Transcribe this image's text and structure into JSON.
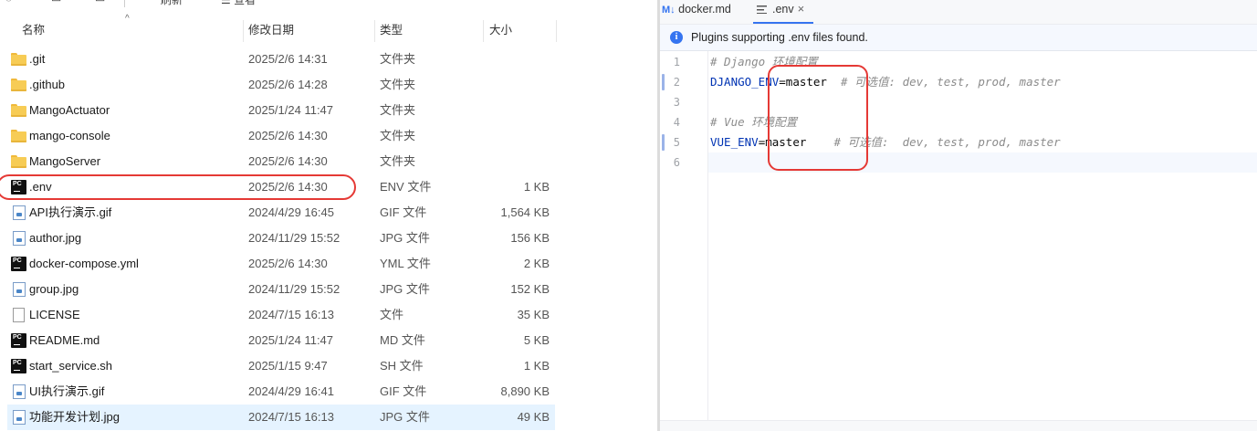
{
  "explorer": {
    "toolbar_fragments": [
      "刷新",
      "查看"
    ],
    "columns": {
      "name": "名称",
      "date": "修改日期",
      "type": "类型",
      "size": "大小"
    },
    "files": [
      {
        "name": ".git",
        "date": "2025/2/6 14:31",
        "type": "文件夹",
        "size": "",
        "icon": "folder-icon"
      },
      {
        "name": ".github",
        "date": "2025/2/6 14:28",
        "type": "文件夹",
        "size": "",
        "icon": "folder-icon"
      },
      {
        "name": "MangoActuator",
        "date": "2025/1/24 11:47",
        "type": "文件夹",
        "size": "",
        "icon": "folder-icon"
      },
      {
        "name": "mango-console",
        "date": "2025/2/6 14:30",
        "type": "文件夹",
        "size": "",
        "icon": "folder-icon"
      },
      {
        "name": "MangoServer",
        "date": "2025/2/6 14:30",
        "type": "文件夹",
        "size": "",
        "icon": "folder-icon"
      },
      {
        "name": ".env",
        "date": "2025/2/6 14:30",
        "type": "ENV 文件",
        "size": "1 KB",
        "icon": "pycharm-file-icon"
      },
      {
        "name": "API执行演示.gif",
        "date": "2024/4/29 16:45",
        "type": "GIF 文件",
        "size": "1,564 KB",
        "icon": "image-file-icon"
      },
      {
        "name": "author.jpg",
        "date": "2024/11/29 15:52",
        "type": "JPG 文件",
        "size": "156 KB",
        "icon": "image-file-icon"
      },
      {
        "name": "docker-compose.yml",
        "date": "2025/2/6 14:30",
        "type": "YML 文件",
        "size": "2 KB",
        "icon": "pycharm-file-icon"
      },
      {
        "name": "group.jpg",
        "date": "2024/11/29 15:52",
        "type": "JPG 文件",
        "size": "152 KB",
        "icon": "image-file-icon"
      },
      {
        "name": "LICENSE",
        "date": "2024/7/15 16:13",
        "type": "文件",
        "size": "35 KB",
        "icon": "blank-file-icon"
      },
      {
        "name": "README.md",
        "date": "2025/1/24 11:47",
        "type": "MD 文件",
        "size": "5 KB",
        "icon": "pycharm-file-icon"
      },
      {
        "name": "start_service.sh",
        "date": "2025/1/15 9:47",
        "type": "SH 文件",
        "size": "1 KB",
        "icon": "pycharm-file-icon"
      },
      {
        "name": "UI执行演示.gif",
        "date": "2024/4/29 16:41",
        "type": "GIF 文件",
        "size": "8,890 KB",
        "icon": "image-file-icon"
      },
      {
        "name": "功能开发计划.jpg",
        "date": "2024/7/15 16:13",
        "type": "JPG 文件",
        "size": "49 KB",
        "icon": "image-file-icon"
      }
    ],
    "selected_index": 14,
    "highlighted_index": 5
  },
  "editor": {
    "tabs": [
      {
        "badge": "M↓",
        "label": "docker.md",
        "active": false
      },
      {
        "label": ".env",
        "active": true,
        "close": "×"
      }
    ],
    "notice": {
      "icon": "i",
      "text": "Plugins supporting .env files found."
    },
    "lines": [
      {
        "n": "1",
        "comment": "# Django 环境配置"
      },
      {
        "n": "2",
        "key": "DJANGO_ENV",
        "op": "=",
        "value": "master",
        "trail": "  # 可选值: dev, test, prod, master"
      },
      {
        "n": "3"
      },
      {
        "n": "4",
        "comment": "# Vue 环境配置"
      },
      {
        "n": "5",
        "key": "VUE_ENV",
        "op": "=",
        "value": "master",
        "trail": "    # 可选值:  dev, test, prod, master"
      },
      {
        "n": "6"
      }
    ],
    "current_line": 6,
    "changed_lines": [
      2,
      5
    ]
  },
  "colors": {
    "annotation": "#e53935",
    "selection": "#cce8ff",
    "accent": "#3574f0",
    "key": "#0033b3",
    "comment": "#8c8c8c"
  }
}
